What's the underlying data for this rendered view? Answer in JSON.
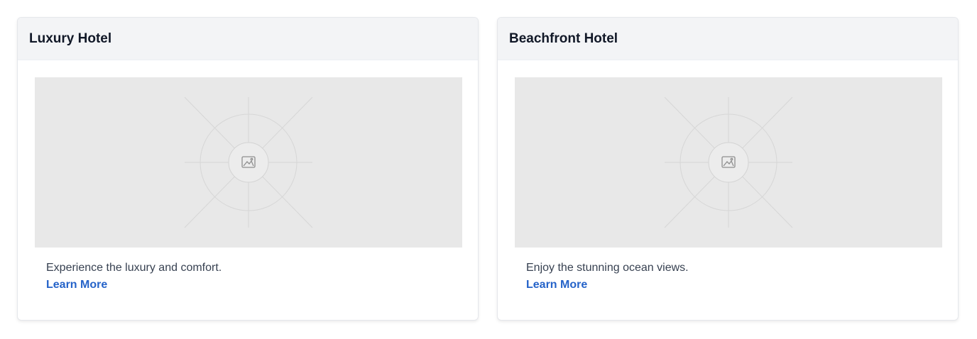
{
  "cards": [
    {
      "title": "Luxury Hotel",
      "image_icon": "image-icon",
      "description": "Experience the luxury and comfort.",
      "link_label": "Learn More"
    },
    {
      "title": "Beachfront Hotel",
      "image_icon": "image-icon",
      "description": "Enjoy the stunning ocean views.",
      "link_label": "Learn More"
    }
  ],
  "colors": {
    "header_bg": "#f3f4f6",
    "placeholder_bg": "#e8e8e8",
    "link": "#2563c9",
    "title": "#111827",
    "text": "#374151"
  }
}
